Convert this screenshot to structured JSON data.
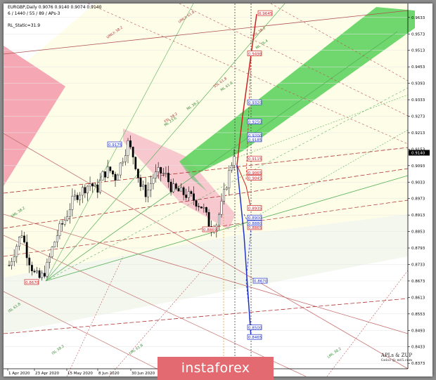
{
  "header": {
    "symbol_line": "EURGBP,Daily  0.9076 0.9140 0.9074 0.9140",
    "params_line": "6 / 1440 / 55 / 89 / APs-3",
    "indicator_line": "RL_Static=31.9"
  },
  "chart_data": {
    "type": "candlestick",
    "symbol": "EURGBP",
    "timeframe": "Daily",
    "ohlc_last": {
      "open": 0.9076,
      "high": 0.914,
      "low": 0.9074,
      "close": 0.914
    },
    "current_price_label": "0.9140",
    "ylim": [
      0.8353,
      0.9653
    ],
    "y_ticks": [
      "0.9633",
      "0.9573",
      "0.9513",
      "0.9453",
      "0.9393",
      "0.9333",
      "0.9273",
      "0.9213",
      "0.9153",
      "0.9093",
      "0.9033",
      "0.8973",
      "0.8913",
      "0.8853",
      "0.8793",
      "0.8733",
      "0.8673",
      "0.8613",
      "0.8553",
      "0.8493",
      "0.8433",
      "0.8373"
    ],
    "x_ticks": [
      "1 Apr 2020",
      "23 Apr 2020",
      "15 May 2020",
      "8 Jun 2020",
      "30 Jun 2020"
    ],
    "price_path": [
      0.873,
      0.879,
      0.885,
      0.876,
      0.87,
      0.868,
      0.872,
      0.88,
      0.886,
      0.89,
      0.896,
      0.899,
      0.901,
      0.903,
      0.9,
      0.906,
      0.908,
      0.905,
      0.911,
      0.9175,
      0.912,
      0.902,
      0.899,
      0.905,
      0.907,
      0.906,
      0.901,
      0.9,
      0.899,
      0.898,
      0.896,
      0.894,
      0.888,
      0.8869,
      0.895,
      0.905,
      0.914
    ],
    "level_labels_red": [
      "0.9645",
      "0.9498",
      "0.9115",
      "0.9065",
      "0.9045",
      "0.8935",
      "0.8865",
      "0.8869",
      "0.8670"
    ],
    "level_labels_blue": [
      "0.9320",
      "0.9250",
      "0.9200",
      "0.9185",
      "0.9175",
      "0.8900",
      "0.8880",
      "0.8670",
      "0.8500",
      "0.8465"
    ],
    "line_labels": [
      "UMLh 38.2",
      "UMLh 61.8",
      "SSL 38.2",
      "SSL 61.8",
      "FSL 38.2",
      "SML 38.2",
      "ML 23.6",
      "ML 38.2",
      "ML 61.8",
      "ML 76.4",
      "ISL 61.8",
      "ISL 38.2",
      "LML 61.8",
      "LML 38.2"
    ]
  },
  "footer": {
    "logo_text": "instaforex",
    "brand_title": "APLs & ZUP",
    "brand_sub": "Geloo @ mt5.com"
  },
  "colors": {
    "background": "#ffffff",
    "pink_zone": "#f5a8b4",
    "green_channel": "#5fd35f",
    "red": "#cc2222",
    "blue": "#2233cc",
    "logo_bg": "#e36a70"
  }
}
